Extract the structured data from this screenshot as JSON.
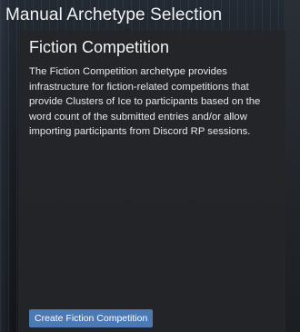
{
  "page": {
    "title": "Manual Archetype Selection"
  },
  "panel": {
    "title": "Fiction Competition",
    "description": "The Fiction Competition archetype provides infrastructure for fiction-related competitions that provide Clusters of Ice to participants based on the word count of the submitted entries and/or allow importing participants from Discord RP sessions.",
    "button_label": "Create Fiction Competition"
  },
  "colors": {
    "accent": "#4c78b3",
    "panel_background": "#252629",
    "page_background": "#14171c"
  }
}
